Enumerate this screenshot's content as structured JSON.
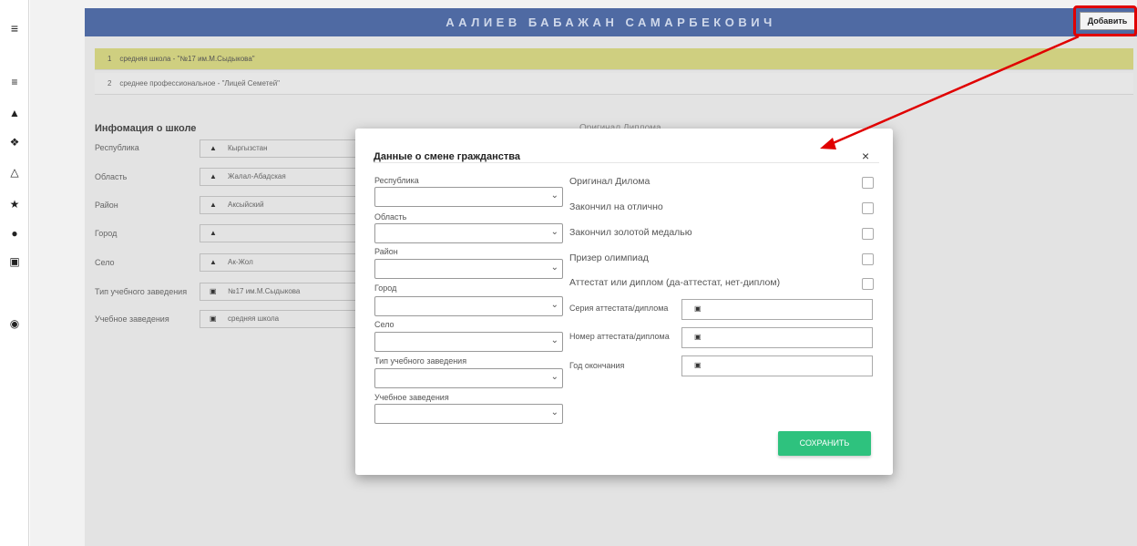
{
  "header": {
    "student_name": "ААЛИЕВ БАБАЖАН САМАРБЕКОВИЧ",
    "add_button": "Добавить"
  },
  "sidebar": {
    "icons": [
      "menu-icon",
      "list-icon",
      "graduation-cap-icon",
      "family-icon",
      "institution-icon",
      "trophy-icon",
      "alert-icon",
      "id-card-icon",
      "location-icon"
    ]
  },
  "education_list": [
    {
      "number": "1",
      "text": "средняя школа - \"№17 им.М.Сыдыкова\""
    },
    {
      "number": "2",
      "text": "среднее профессиональное - \"Лицей Семетей\""
    }
  ],
  "school_info": {
    "title": "Инфомация о школе",
    "original_diploma_label": "Оригинал Диплома",
    "fields": [
      {
        "label": "Республика",
        "value": "Кыргызстан"
      },
      {
        "label": "Область",
        "value": "Жалал-Абадская"
      },
      {
        "label": "Район",
        "value": "Аксыйский"
      },
      {
        "label": "Город",
        "value": ""
      },
      {
        "label": "Село",
        "value": "Ак-Жол"
      },
      {
        "label": "Тип учебного заведения",
        "value": "№17 им.М.Сыдыкова"
      },
      {
        "label": "Учебное заведения",
        "value": "средняя школа"
      }
    ]
  },
  "modal": {
    "title": "Данные о смене гражданства",
    "close": "×",
    "selects": [
      {
        "label": "Республика",
        "value": ""
      },
      {
        "label": "Область",
        "value": ""
      },
      {
        "label": "Район",
        "value": ""
      },
      {
        "label": "Город",
        "value": ""
      },
      {
        "label": "Село",
        "value": ""
      },
      {
        "label": "Тип учебного заведения",
        "value": ""
      },
      {
        "label": "Учебное заведения",
        "value": ""
      }
    ],
    "checkboxes": [
      {
        "label": "Оригинал Дилома",
        "checked": false
      },
      {
        "label": "Закончил на отлично",
        "checked": false
      },
      {
        "label": "Закончил золотой медалью",
        "checked": false
      },
      {
        "label": "Призер олимпиад",
        "checked": false
      },
      {
        "label": "Аттестат или диплом (да-аттестат, нет-диплом)",
        "checked": false
      }
    ],
    "inputs": [
      {
        "label": "Серия аттестата/диплома",
        "value": ""
      },
      {
        "label": "Номер аттестата/диплома",
        "value": ""
      },
      {
        "label": "Год окончания",
        "value": ""
      }
    ],
    "save_button": "СОХРАНИТЬ"
  },
  "colors": {
    "header": "#4f6aa3",
    "highlight_row": "#cfcf80",
    "save": "#2ec27e",
    "annotation": "#e00000"
  }
}
